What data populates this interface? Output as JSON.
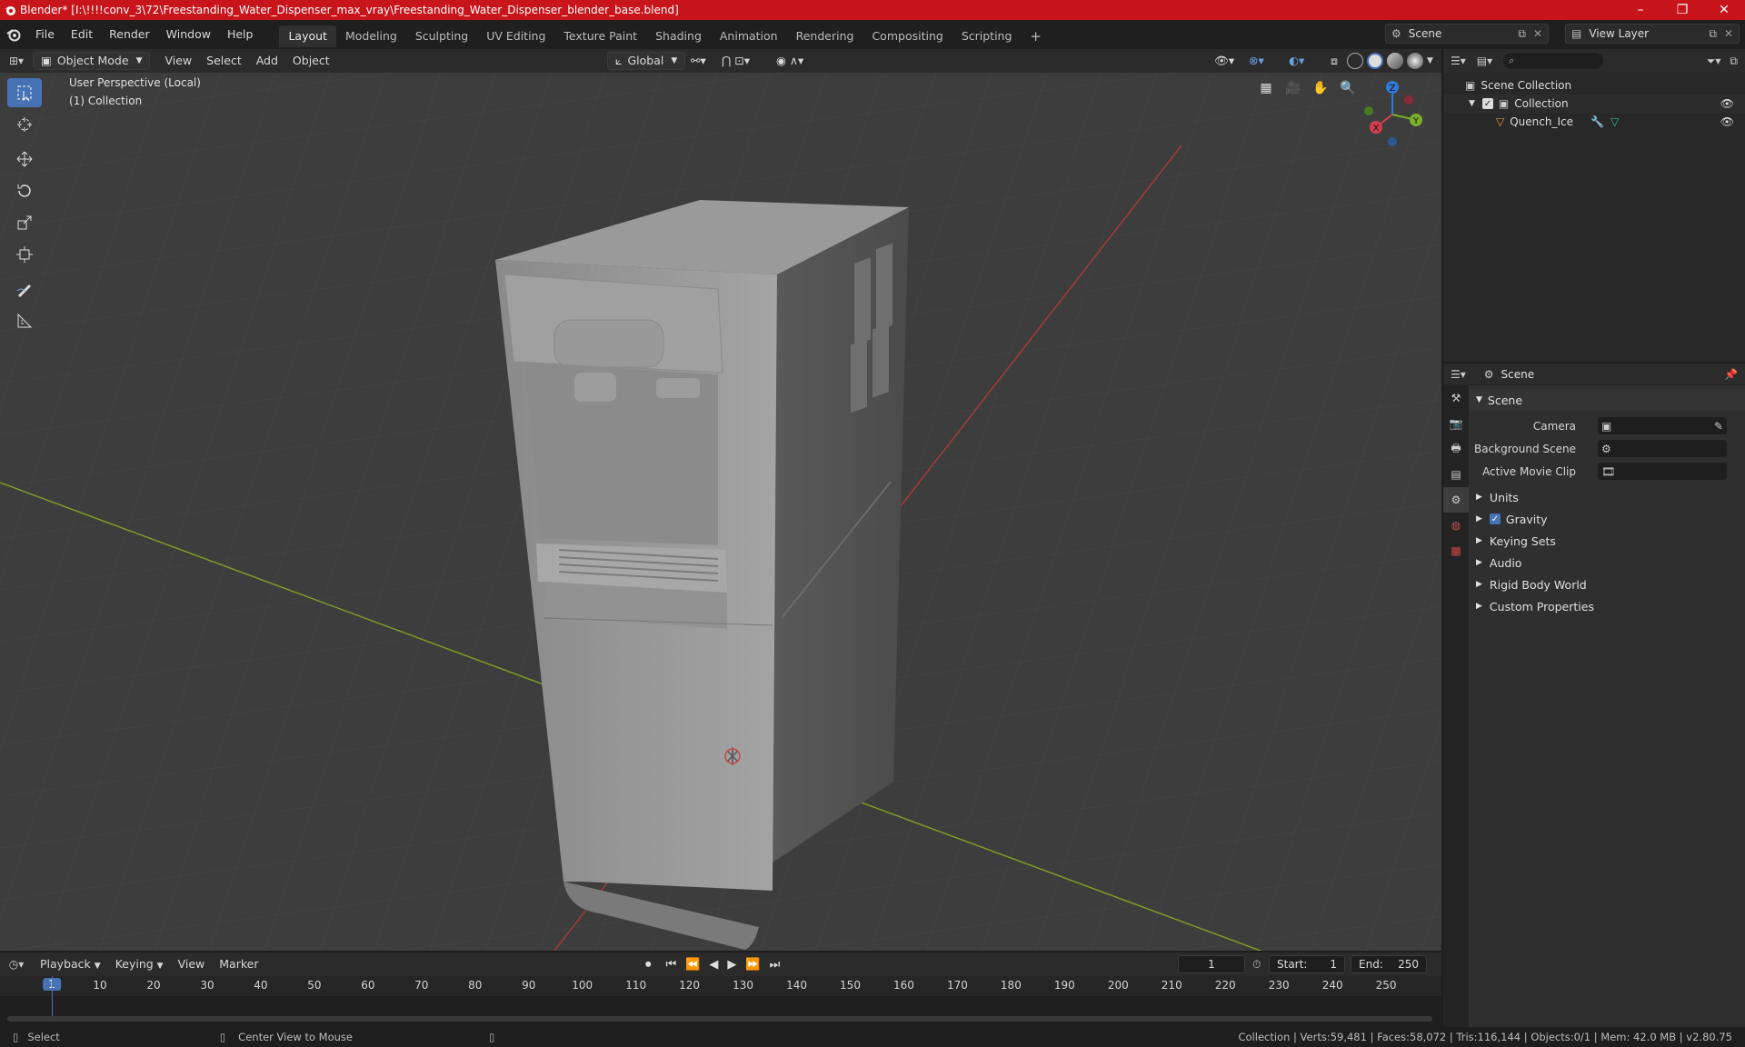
{
  "window": {
    "title": "Blender* [I:\\!!!!conv_3\\72\\Freestanding_Water_Dispenser_max_vray\\Freestanding_Water_Dispenser_blender_base.blend]",
    "minimize": "–",
    "maximize": "❐",
    "close": "✕"
  },
  "menu": {
    "items": [
      "File",
      "Edit",
      "Render",
      "Window",
      "Help"
    ]
  },
  "workspaces": {
    "tabs": [
      "Layout",
      "Modeling",
      "Sculpting",
      "UV Editing",
      "Texture Paint",
      "Shading",
      "Animation",
      "Rendering",
      "Compositing",
      "Scripting"
    ],
    "add": "+"
  },
  "scene_selector": {
    "scene": "Scene",
    "view_layer": "View Layer"
  },
  "viewport_header": {
    "mode": "Object Mode",
    "view": "View",
    "select": "Select",
    "add": "Add",
    "object": "Object",
    "transform": "Global"
  },
  "viewport": {
    "perspective": "User Perspective (Local)",
    "collection": "(1) Collection",
    "axis_x": "X",
    "axis_y": "Y",
    "axis_z": "Z"
  },
  "outliner": {
    "scene_collection": "Scene Collection",
    "collection": "Collection",
    "object": "Quench_Ice"
  },
  "properties": {
    "header": "Scene",
    "panel": "Scene",
    "camera_label": "Camera",
    "background_label": "Background Scene",
    "clip_label": "Active Movie Clip",
    "sections": [
      "Units",
      "Gravity",
      "Keying Sets",
      "Audio",
      "Rigid Body World",
      "Custom Properties"
    ]
  },
  "timeline": {
    "playback": "Playback",
    "keying": "Keying",
    "view": "View",
    "marker": "Marker",
    "current_frame": "1",
    "start_label": "Start:",
    "start": "1",
    "end_label": "End:",
    "end": "250",
    "ticks": [
      "1",
      "10",
      "20",
      "30",
      "40",
      "50",
      "60",
      "70",
      "80",
      "90",
      "100",
      "110",
      "120",
      "130",
      "140",
      "150",
      "160",
      "170",
      "180",
      "190",
      "200",
      "210",
      "220",
      "230",
      "240",
      "250"
    ]
  },
  "status": {
    "select": "Select",
    "center": "Center View to Mouse",
    "stats": "Collection | Verts:59,481 | Faces:58,072 | Tris:116,144 | Objects:0/1 | Mem: 42.0 MB | v2.80.75"
  },
  "colors": {
    "accent": "#4772b3",
    "title_bar": "#c8141b",
    "x_axis": "#a43a3a",
    "y_axis": "#7e9b27"
  }
}
